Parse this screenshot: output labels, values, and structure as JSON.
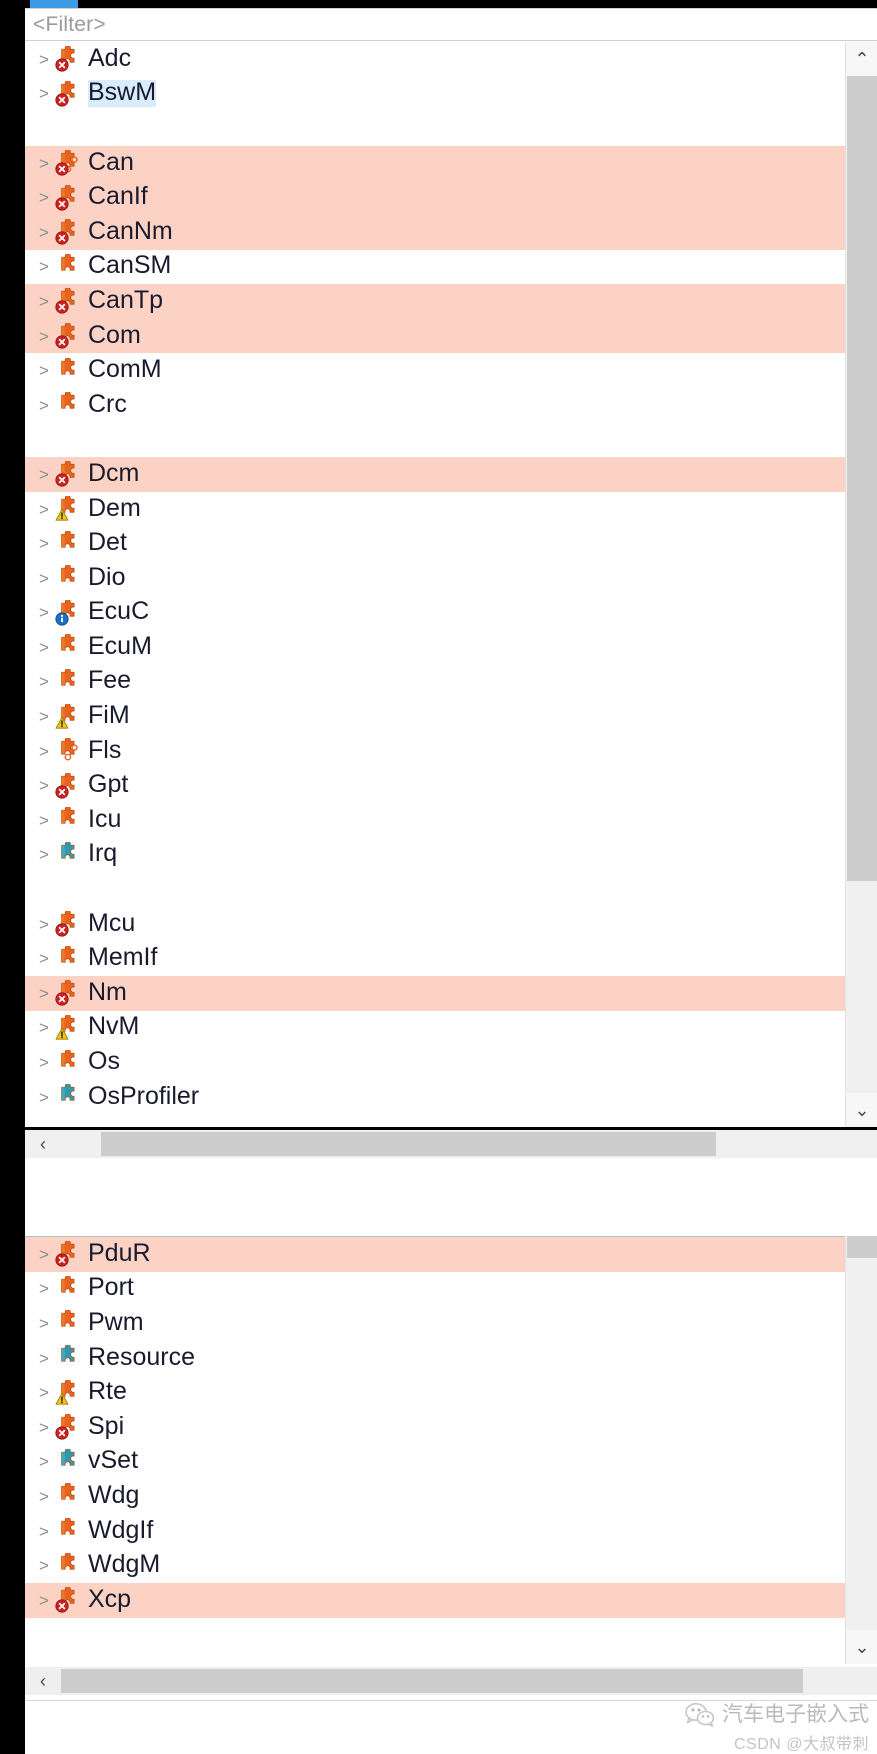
{
  "window": {
    "title_tab_color": "#3b9ae1",
    "background": "#ffffff"
  },
  "filter": {
    "placeholder": "<Filter>",
    "value": "<Filter>"
  },
  "colors": {
    "highlight_row": "#fbd2c4",
    "selection": "#d9ecfb",
    "icon_orange": "#e8631e",
    "icon_teal": "#2f9aad",
    "error_red": "#cc2222",
    "warning_yellow": "#f5c518",
    "info_blue": "#1b6fc4",
    "text": "#1a1a2e",
    "placeholder_text": "#9a9a9a"
  },
  "scrollbars": {
    "up_arrow": "⌃",
    "down_arrow": "⌄",
    "left_arrow": "‹",
    "right_arrow": "›"
  },
  "tree_top": {
    "items": [
      {
        "label": "Adc",
        "icon": "puzzle-error-icon",
        "twisty": ">",
        "highlight": false,
        "selected": false
      },
      {
        "label": "BswM",
        "icon": "puzzle-error-icon",
        "twisty": ">",
        "highlight": false,
        "selected": true
      },
      {
        "label": "",
        "icon": "none",
        "twisty": "",
        "highlight": false,
        "selected": false,
        "spacer": true
      },
      {
        "label": "Can",
        "icon": "puzzle-error-open-icon",
        "twisty": ">",
        "highlight": true,
        "selected": false
      },
      {
        "label": "CanIf",
        "icon": "puzzle-error-icon",
        "twisty": ">",
        "highlight": true,
        "selected": false
      },
      {
        "label": "CanNm",
        "icon": "puzzle-error-icon",
        "twisty": ">",
        "highlight": true,
        "selected": false
      },
      {
        "label": "CanSM",
        "icon": "puzzle-icon",
        "twisty": ">",
        "highlight": false,
        "selected": false
      },
      {
        "label": "CanTp",
        "icon": "puzzle-error-icon",
        "twisty": ">",
        "highlight": true,
        "selected": false
      },
      {
        "label": "Com",
        "icon": "puzzle-error-icon",
        "twisty": ">",
        "highlight": true,
        "selected": false
      },
      {
        "label": "ComM",
        "icon": "puzzle-icon",
        "twisty": ">",
        "highlight": false,
        "selected": false
      },
      {
        "label": "Crc",
        "icon": "puzzle-icon",
        "twisty": ">",
        "highlight": false,
        "selected": false
      },
      {
        "label": "",
        "icon": "none",
        "twisty": "",
        "highlight": false,
        "selected": false,
        "spacer": true
      },
      {
        "label": "Dcm",
        "icon": "puzzle-error-icon",
        "twisty": ">",
        "highlight": true,
        "selected": false
      },
      {
        "label": "Dem",
        "icon": "puzzle-warning-icon",
        "twisty": ">",
        "highlight": false,
        "selected": false
      },
      {
        "label": "Det",
        "icon": "puzzle-icon",
        "twisty": ">",
        "highlight": false,
        "selected": false
      },
      {
        "label": "Dio",
        "icon": "puzzle-icon",
        "twisty": ">",
        "highlight": false,
        "selected": false
      },
      {
        "label": "EcuC",
        "icon": "puzzle-info-icon",
        "twisty": ">",
        "highlight": false,
        "selected": false
      },
      {
        "label": "EcuM",
        "icon": "puzzle-icon",
        "twisty": ">",
        "highlight": false,
        "selected": false
      },
      {
        "label": "Fee",
        "icon": "puzzle-icon",
        "twisty": ">",
        "highlight": false,
        "selected": false
      },
      {
        "label": "FiM",
        "icon": "puzzle-warning-icon",
        "twisty": ">",
        "highlight": false,
        "selected": false
      },
      {
        "label": "Fls",
        "icon": "puzzle-open-icon",
        "twisty": ">",
        "highlight": false,
        "selected": false
      },
      {
        "label": "Gpt",
        "icon": "puzzle-error-icon",
        "twisty": ">",
        "highlight": false,
        "selected": false
      },
      {
        "label": "Icu",
        "icon": "puzzle-icon",
        "twisty": ">",
        "highlight": false,
        "selected": false
      },
      {
        "label": "Irq",
        "icon": "puzzle-teal-icon",
        "twisty": ">",
        "highlight": false,
        "selected": false
      },
      {
        "label": "",
        "icon": "none",
        "twisty": "",
        "highlight": false,
        "selected": false,
        "spacer": true
      },
      {
        "label": "Mcu",
        "icon": "puzzle-error-icon",
        "twisty": ">",
        "highlight": false,
        "selected": false
      },
      {
        "label": "MemIf",
        "icon": "puzzle-icon",
        "twisty": ">",
        "highlight": false,
        "selected": false
      },
      {
        "label": "Nm",
        "icon": "puzzle-error-icon",
        "twisty": ">",
        "highlight": true,
        "selected": false
      },
      {
        "label": "NvM",
        "icon": "puzzle-warning-icon",
        "twisty": ">",
        "highlight": false,
        "selected": false
      },
      {
        "label": "Os",
        "icon": "puzzle-icon",
        "twisty": ">",
        "highlight": false,
        "selected": false
      },
      {
        "label": "OsProfiler",
        "icon": "puzzle-teal-icon",
        "twisty": ">",
        "highlight": false,
        "selected": false
      }
    ]
  },
  "tree_bottom": {
    "items": [
      {
        "label": "PduR",
        "icon": "puzzle-error-icon",
        "twisty": ">",
        "highlight": true,
        "selected": false
      },
      {
        "label": "Port",
        "icon": "puzzle-icon",
        "twisty": ">",
        "highlight": false,
        "selected": false
      },
      {
        "label": "Pwm",
        "icon": "puzzle-icon",
        "twisty": ">",
        "highlight": false,
        "selected": false
      },
      {
        "label": "Resource",
        "icon": "puzzle-teal-icon",
        "twisty": ">",
        "highlight": false,
        "selected": false
      },
      {
        "label": "Rte",
        "icon": "puzzle-warning-icon",
        "twisty": ">",
        "highlight": false,
        "selected": false
      },
      {
        "label": "Spi",
        "icon": "puzzle-error-icon",
        "twisty": ">",
        "highlight": false,
        "selected": false
      },
      {
        "label": "vSet",
        "icon": "puzzle-teal-icon",
        "twisty": ">",
        "highlight": false,
        "selected": false
      },
      {
        "label": "Wdg",
        "icon": "puzzle-icon",
        "twisty": ">",
        "highlight": false,
        "selected": false
      },
      {
        "label": "WdgIf",
        "icon": "puzzle-icon",
        "twisty": ">",
        "highlight": false,
        "selected": false
      },
      {
        "label": "WdgM",
        "icon": "puzzle-icon",
        "twisty": ">",
        "highlight": false,
        "selected": false
      },
      {
        "label": "Xcp",
        "icon": "puzzle-error-icon",
        "twisty": ">",
        "highlight": true,
        "selected": false
      }
    ]
  },
  "watermark": {
    "line1": "汽车电子嵌入式",
    "line2": "CSDN @大叔带刺"
  }
}
